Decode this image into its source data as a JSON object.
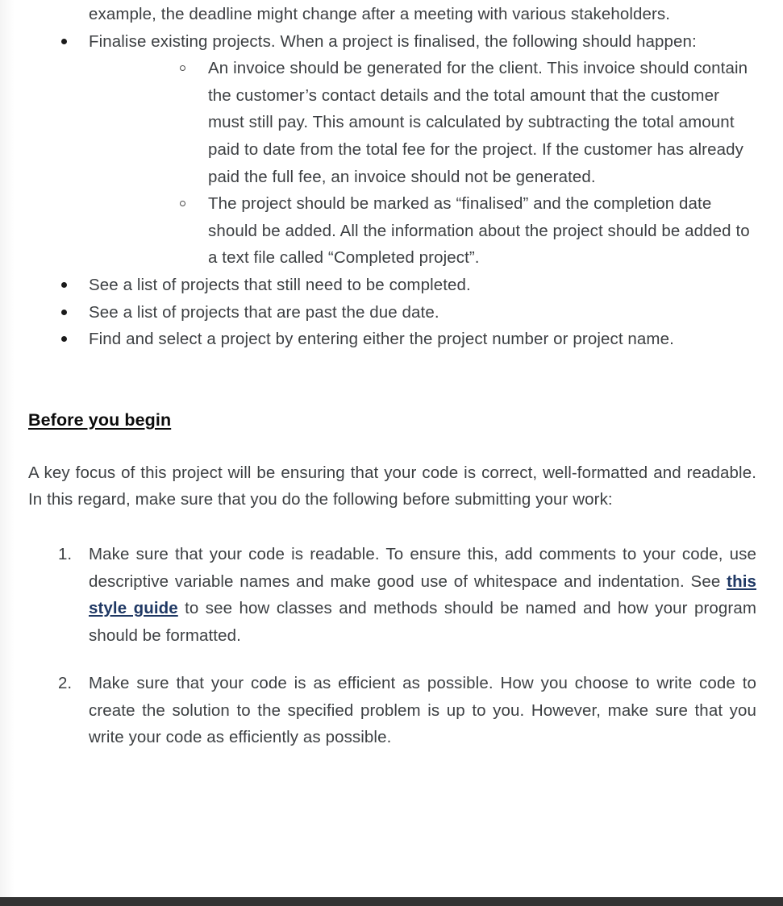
{
  "document": {
    "continuation_paragraph": "example, the deadline might change after a meeting with various stakeholders.",
    "requirements_bullets": [
      {
        "text": "Finalise existing projects. When a project is finalised, the following should happen:",
        "subitems": [
          "An invoice should be generated for the client. This invoice should contain the customer’s contact details and the total amount that the customer must still pay. This amount is calculated by subtracting the total amount paid to date from the total fee for the project. If the customer has already paid the full fee, an invoice should not be generated.",
          "The project should be marked as “finalised” and the completion date should be added. All the information about the project should be added to a text file called “Completed project”."
        ]
      },
      {
        "text": "See a list of projects that still need to be completed.",
        "subitems": []
      },
      {
        "text": "See a list of projects that are past the due date.",
        "subitems": []
      },
      {
        "text": "Find and select a project by entering either the project number or project name.",
        "subitems": []
      }
    ],
    "section_heading": "Before you begin",
    "intro_paragraph": "A key focus of this project will be ensuring that your code is correct, well-formatted and readable. In this regard, make sure that you do the following before submitting your work:",
    "numbered_items": [
      {
        "number": "1.",
        "text_before_link": "Make sure that your code is readable. To ensure this, add comments to your code, use descriptive variable names and make good use of whitespace and indentation. See ",
        "link_text": "this style guide",
        "text_after_link": " to see how classes and methods should be named and how your program should be formatted."
      },
      {
        "number": "2.",
        "text_before_link": "Make sure that your code is as efficient as possible. How you choose to write code to create the solution to the specified problem is up to you. However, make sure that you write your code as efficiently as possible.",
        "link_text": "",
        "text_after_link": ""
      }
    ],
    "colors": {
      "body_text": "#3d4043",
      "heading_text": "#0b0b0b",
      "link": "#1f3864",
      "bottom_bar": "#333333",
      "page_background": "#ffffff"
    }
  }
}
